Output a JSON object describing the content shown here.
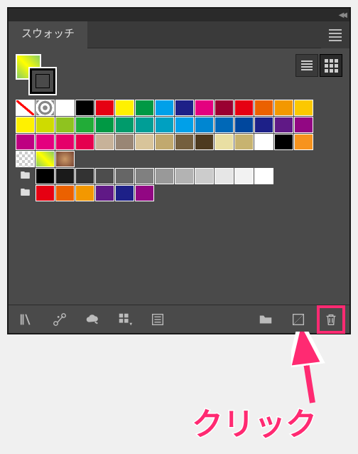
{
  "panel": {
    "tab_label": "スウォッチ",
    "view_mode": "grid"
  },
  "swatches": {
    "row1": [
      {
        "type": "none"
      },
      {
        "type": "reg"
      },
      {
        "type": "plain",
        "c": "#ffffff"
      },
      {
        "type": "plain",
        "c": "#000000"
      },
      {
        "type": "plain",
        "c": "#e60012"
      },
      {
        "type": "plain",
        "c": "#fff100"
      },
      {
        "type": "plain",
        "c": "#009944"
      },
      {
        "type": "plain",
        "c": "#00a0e9"
      },
      {
        "type": "plain",
        "c": "#1d2088"
      },
      {
        "type": "plain",
        "c": "#e4007f"
      },
      {
        "type": "plain",
        "c": "#9a0031"
      },
      {
        "type": "plain",
        "c": "#e60012"
      },
      {
        "type": "plain",
        "c": "#eb6100"
      },
      {
        "type": "plain",
        "c": "#f39800"
      },
      {
        "type": "plain",
        "c": "#fcc800"
      }
    ],
    "row2": [
      {
        "type": "plain",
        "c": "#fff100"
      },
      {
        "type": "plain",
        "c": "#cfdb00"
      },
      {
        "type": "plain",
        "c": "#8fc31f"
      },
      {
        "type": "plain",
        "c": "#22ac38"
      },
      {
        "type": "plain",
        "c": "#009944"
      },
      {
        "type": "plain",
        "c": "#009b6b"
      },
      {
        "type": "plain",
        "c": "#009e96"
      },
      {
        "type": "plain",
        "c": "#00a0c1"
      },
      {
        "type": "plain",
        "c": "#00a0e9"
      },
      {
        "type": "plain",
        "c": "#0086d1"
      },
      {
        "type": "plain",
        "c": "#0068b7"
      },
      {
        "type": "plain",
        "c": "#00479d"
      },
      {
        "type": "plain",
        "c": "#1d2088"
      },
      {
        "type": "plain",
        "c": "#601986"
      },
      {
        "type": "plain",
        "c": "#920783"
      }
    ],
    "row3": [
      {
        "type": "plain",
        "c": "#be0081"
      },
      {
        "type": "plain",
        "c": "#e4007f"
      },
      {
        "type": "plain",
        "c": "#e5006a"
      },
      {
        "type": "plain",
        "c": "#e5004f"
      },
      {
        "type": "plain",
        "c": "#c7b299"
      },
      {
        "type": "plain",
        "c": "#998675"
      },
      {
        "type": "plain",
        "c": "#d8c49a"
      },
      {
        "type": "plain",
        "c": "#c1a96e"
      },
      {
        "type": "plain",
        "c": "#745f3e"
      },
      {
        "type": "plain",
        "c": "#4d3a1f"
      },
      {
        "type": "plain",
        "c": "#e9dfa3"
      },
      {
        "type": "plain",
        "c": "#c7b370"
      },
      {
        "type": "plain",
        "c": "#ffffff"
      },
      {
        "type": "plain",
        "c": "#000000"
      },
      {
        "type": "plain",
        "c": "#f7931e"
      }
    ],
    "row4": [
      {
        "type": "chk"
      },
      {
        "type": "pat1"
      },
      {
        "type": "pat2"
      }
    ],
    "group1": [
      {
        "type": "plain",
        "c": "#000000"
      },
      {
        "type": "plain",
        "c": "#1a1a1a"
      },
      {
        "type": "plain",
        "c": "#333333"
      },
      {
        "type": "plain",
        "c": "#4d4d4d"
      },
      {
        "type": "plain",
        "c": "#666666"
      },
      {
        "type": "plain",
        "c": "#808080"
      },
      {
        "type": "plain",
        "c": "#999999"
      },
      {
        "type": "plain",
        "c": "#b3b3b3"
      },
      {
        "type": "plain",
        "c": "#cccccc"
      },
      {
        "type": "plain",
        "c": "#e6e6e6"
      },
      {
        "type": "plain",
        "c": "#f2f2f2"
      },
      {
        "type": "plain",
        "c": "#ffffff"
      }
    ],
    "group2": [
      {
        "type": "plain",
        "c": "#e60012"
      },
      {
        "type": "plain",
        "c": "#eb6100"
      },
      {
        "type": "plain",
        "c": "#f39800"
      },
      {
        "type": "plain",
        "c": "#601986"
      },
      {
        "type": "plain",
        "c": "#1d2088"
      },
      {
        "type": "plain",
        "c": "#920783"
      }
    ]
  },
  "bottom_bar": {
    "items": [
      {
        "name": "libraries-icon"
      },
      {
        "name": "link-icon"
      },
      {
        "name": "cloud-icon"
      },
      {
        "name": "options-grid-icon"
      },
      {
        "name": "new-color-group-icon"
      },
      {
        "name": "folder-icon"
      },
      {
        "name": "new-swatch-icon"
      },
      {
        "name": "trash-icon",
        "highlight": true
      }
    ]
  },
  "callout": {
    "label": "クリック"
  }
}
